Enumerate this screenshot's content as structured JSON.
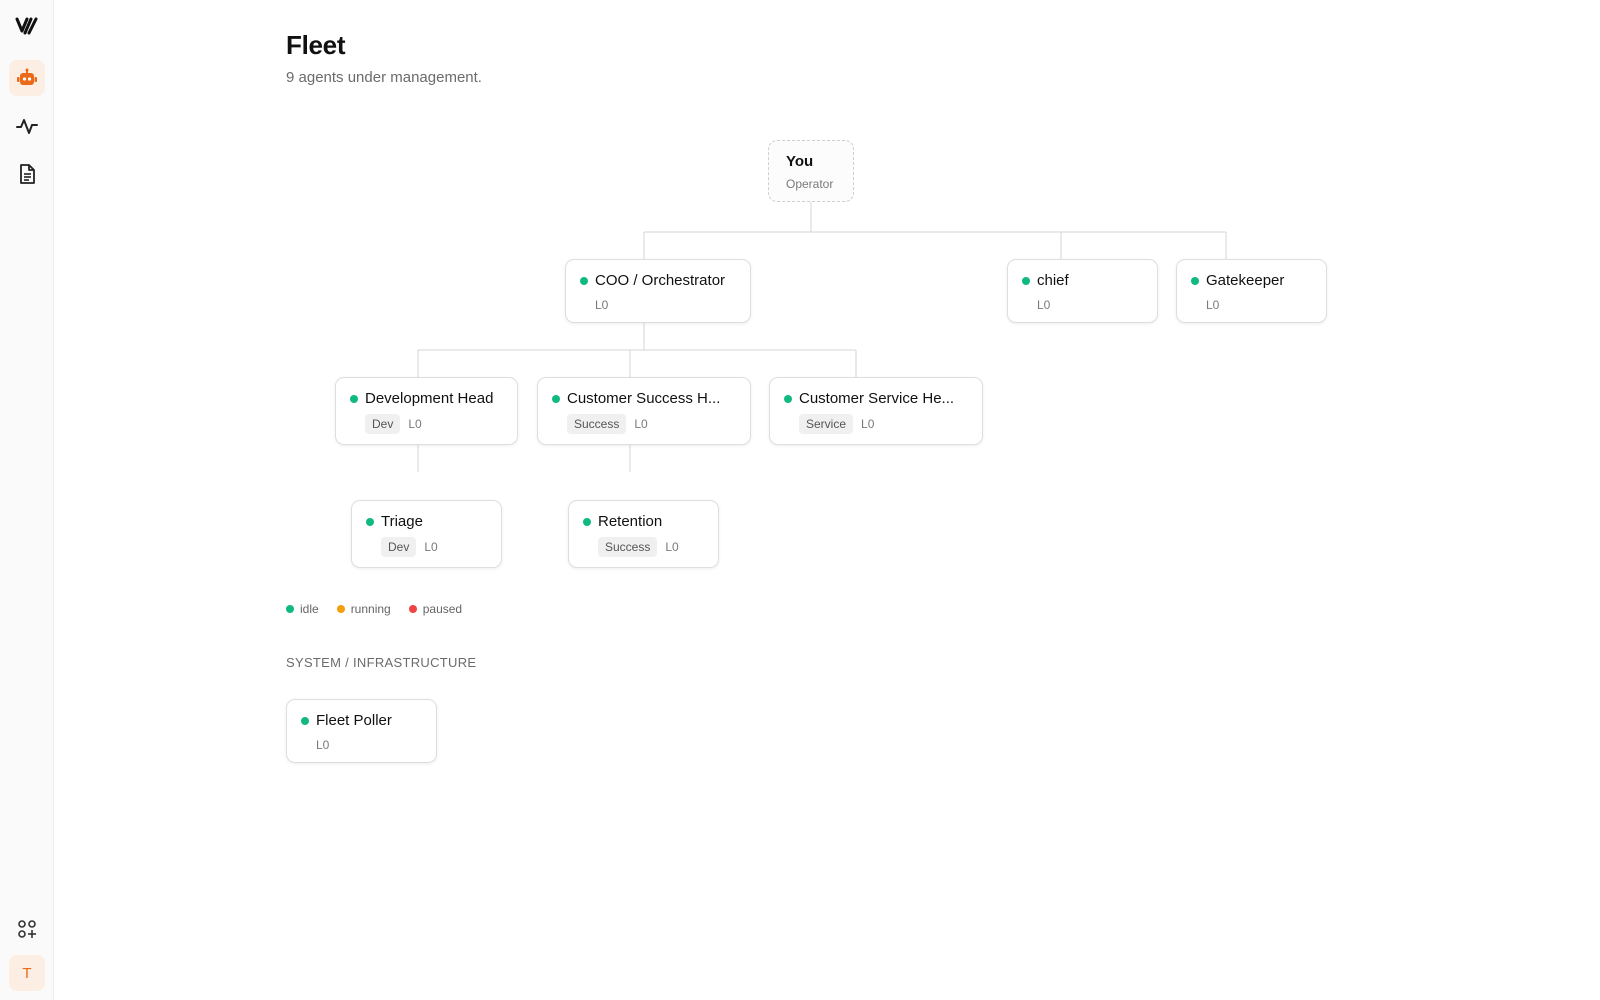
{
  "app": {
    "logo_text": "Y/"
  },
  "sidebar": {
    "items": [
      {
        "name": "agents",
        "icon": "robot-icon",
        "active": true
      },
      {
        "name": "activity",
        "icon": "activity-pulse-icon",
        "active": false
      },
      {
        "name": "documents",
        "icon": "document-icon",
        "active": false
      }
    ],
    "bottom": {
      "apps_icon": "apps-add-icon",
      "avatar_initial": "T"
    }
  },
  "page": {
    "title": "Fleet",
    "subtitle": "9 agents under management."
  },
  "colors": {
    "accent": "#ea6a1a",
    "idle": "#10b981",
    "running": "#f59e0b",
    "paused": "#ef4444"
  },
  "root": {
    "name": "You",
    "role": "Operator"
  },
  "agents": {
    "coo": {
      "name": "COO / Orchestrator",
      "level": "L0",
      "status": "idle"
    },
    "chief": {
      "name": "chief",
      "level": "L0",
      "status": "idle"
    },
    "gatekeeper": {
      "name": "Gatekeeper",
      "level": "L0",
      "status": "idle"
    },
    "dev_head": {
      "name": "Development Head",
      "tag": "Dev",
      "level": "L0",
      "status": "idle"
    },
    "cs_head": {
      "name": "Customer Success H...",
      "tag": "Success",
      "level": "L0",
      "status": "idle"
    },
    "service_head": {
      "name": "Customer Service He...",
      "tag": "Service",
      "level": "L0",
      "status": "idle"
    },
    "triage": {
      "name": "Triage",
      "tag": "Dev",
      "level": "L0",
      "status": "idle"
    },
    "retention": {
      "name": "Retention",
      "tag": "Success",
      "level": "L0",
      "status": "idle"
    }
  },
  "legend": {
    "idle": "idle",
    "running": "running",
    "paused": "paused"
  },
  "system": {
    "label": "SYSTEM / INFRASTRUCTURE",
    "poller": {
      "name": "Fleet Poller",
      "level": "L0",
      "status": "idle"
    }
  }
}
